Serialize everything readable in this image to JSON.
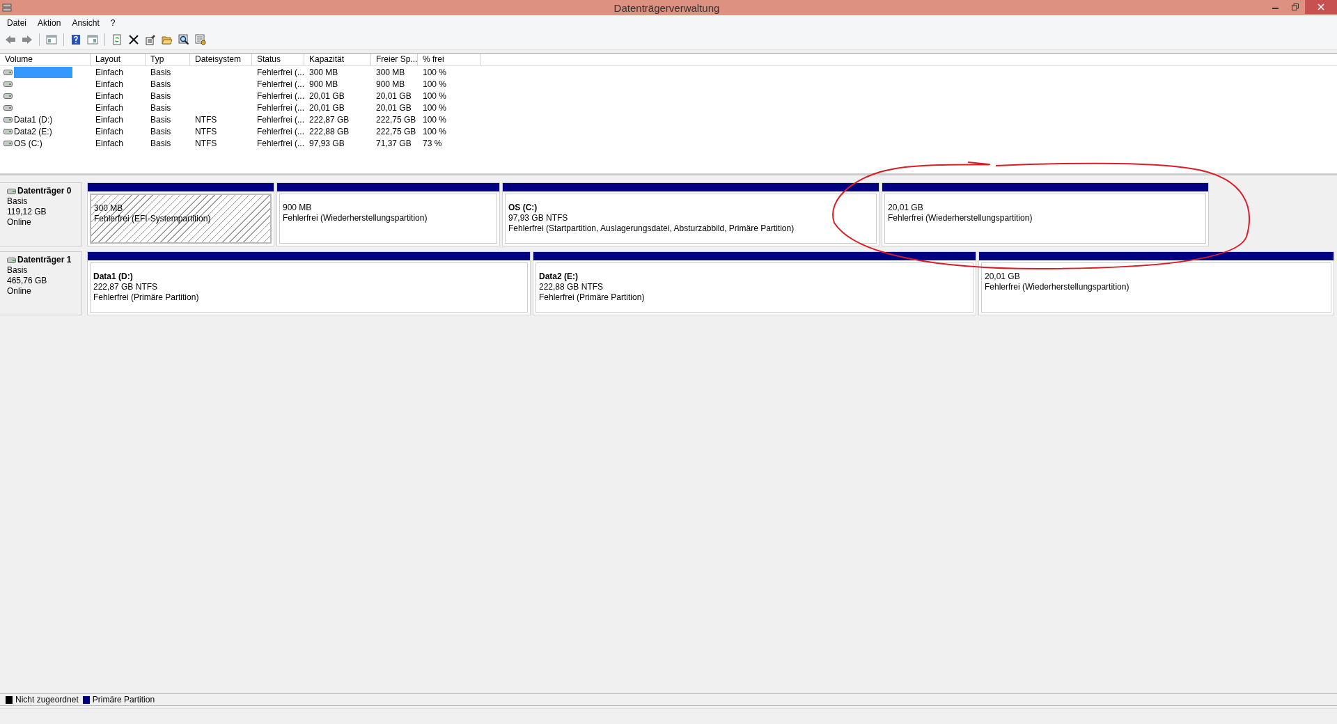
{
  "window": {
    "title": "Datenträgerverwaltung"
  },
  "menu": [
    "Datei",
    "Aktion",
    "Ansicht",
    "?"
  ],
  "table": {
    "columns": [
      "Volume",
      "Layout",
      "Typ",
      "Dateisystem",
      "Status",
      "Kapazität",
      "Freier Sp...",
      "% frei"
    ],
    "rows": [
      {
        "selected": true,
        "layout": "Einfach",
        "type": "Basis",
        "status": "Fehlerfrei (...",
        "capacity": "300 MB",
        "free": "300 MB",
        "percent_free": "100 %"
      },
      {
        "selected": false,
        "layout": "Einfach",
        "type": "Basis",
        "status": "Fehlerfrei (...",
        "capacity": "900 MB",
        "free": "900 MB",
        "percent_free": "100 %"
      },
      {
        "selected": false,
        "layout": "Einfach",
        "type": "Basis",
        "status": "Fehlerfrei (...",
        "capacity": "20,01 GB",
        "free": "20,01 GB",
        "percent_free": "100 %"
      },
      {
        "selected": false,
        "layout": "Einfach",
        "type": "Basis",
        "status": "Fehlerfrei (...",
        "capacity": "20,01 GB",
        "free": "20,01 GB",
        "percent_free": "100 %"
      },
      {
        "selected": false,
        "volume": "Data1 (D:)",
        "layout": "Einfach",
        "type": "Basis",
        "filesystem": "NTFS",
        "status": "Fehlerfrei (...",
        "capacity": "222,87 GB",
        "free": "222,75 GB",
        "percent_free": "100 %"
      },
      {
        "selected": false,
        "volume": "Data2 (E:)",
        "layout": "Einfach",
        "type": "Basis",
        "filesystem": "NTFS",
        "status": "Fehlerfrei (...",
        "capacity": "222,88 GB",
        "free": "222,75 GB",
        "percent_free": "100 %"
      },
      {
        "selected": false,
        "volume": "OS (C:)",
        "layout": "Einfach",
        "type": "Basis",
        "filesystem": "NTFS",
        "status": "Fehlerfrei (...",
        "capacity": "97,93 GB",
        "free": "71,37 GB",
        "percent_free": "73 %"
      }
    ]
  },
  "disks": [
    {
      "name": "Datenträger 0",
      "type": "Basis",
      "size": "119,12 GB",
      "state": "Online",
      "partitions": [
        {
          "selected": true,
          "size": "300 MB",
          "status": "Fehlerfrei (EFI-Systempartition)"
        },
        {
          "selected": false,
          "size": "900 MB",
          "status": "Fehlerfrei (Wiederherstellungspartition)"
        },
        {
          "selected": false,
          "name": "OS  (C:)",
          "size": "97,93 GB NTFS",
          "status": "Fehlerfrei (Startpartition, Auslagerungsdatei, Absturzabbild, Primäre Partition)"
        },
        {
          "selected": false,
          "size": "20,01 GB",
          "status": "Fehlerfrei (Wiederherstellungspartition)"
        }
      ]
    },
    {
      "name": "Datenträger 1",
      "type": "Basis",
      "size": "465,76 GB",
      "state": "Online",
      "partitions": [
        {
          "selected": false,
          "name": "Data1  (D:)",
          "size": "222,87 GB NTFS",
          "status": "Fehlerfrei (Primäre Partition)"
        },
        {
          "selected": false,
          "name": "Data2  (E:)",
          "size": "222,88 GB NTFS",
          "status": "Fehlerfrei (Primäre Partition)"
        },
        {
          "selected": false,
          "size": "20,01 GB",
          "status": "Fehlerfrei (Wiederherstellungspartition)"
        }
      ]
    }
  ],
  "legend": [
    {
      "label": "Nicht zugeordnet",
      "color": "#000000"
    },
    {
      "label": "Primäre Partition",
      "color": "#000080"
    }
  ]
}
